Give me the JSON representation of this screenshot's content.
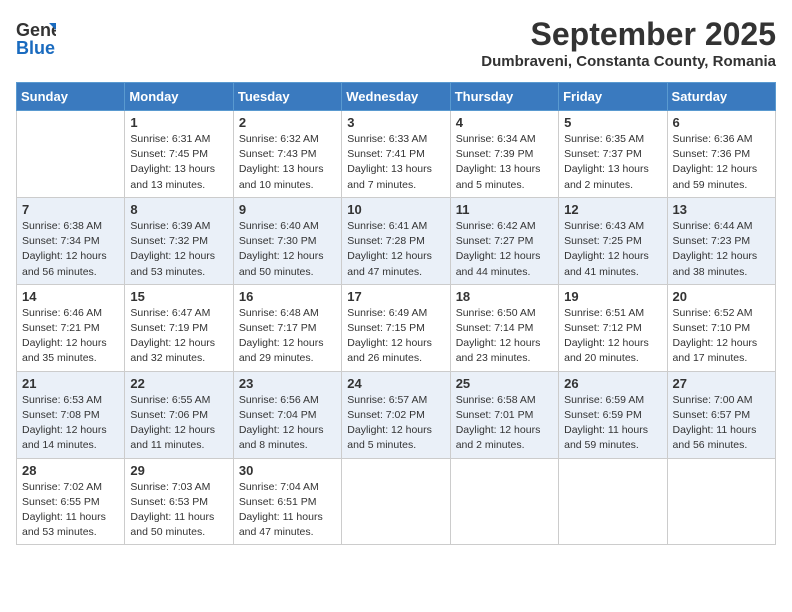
{
  "header": {
    "logo_general": "General",
    "logo_blue": "Blue",
    "month": "September 2025",
    "location": "Dumbraveni, Constanta County, Romania"
  },
  "weekdays": [
    "Sunday",
    "Monday",
    "Tuesday",
    "Wednesday",
    "Thursday",
    "Friday",
    "Saturday"
  ],
  "weeks": [
    [
      {
        "day": "",
        "sunrise": "",
        "sunset": "",
        "daylight": ""
      },
      {
        "day": "1",
        "sunrise": "Sunrise: 6:31 AM",
        "sunset": "Sunset: 7:45 PM",
        "daylight": "Daylight: 13 hours and 13 minutes."
      },
      {
        "day": "2",
        "sunrise": "Sunrise: 6:32 AM",
        "sunset": "Sunset: 7:43 PM",
        "daylight": "Daylight: 13 hours and 10 minutes."
      },
      {
        "day": "3",
        "sunrise": "Sunrise: 6:33 AM",
        "sunset": "Sunset: 7:41 PM",
        "daylight": "Daylight: 13 hours and 7 minutes."
      },
      {
        "day": "4",
        "sunrise": "Sunrise: 6:34 AM",
        "sunset": "Sunset: 7:39 PM",
        "daylight": "Daylight: 13 hours and 5 minutes."
      },
      {
        "day": "5",
        "sunrise": "Sunrise: 6:35 AM",
        "sunset": "Sunset: 7:37 PM",
        "daylight": "Daylight: 13 hours and 2 minutes."
      },
      {
        "day": "6",
        "sunrise": "Sunrise: 6:36 AM",
        "sunset": "Sunset: 7:36 PM",
        "daylight": "Daylight: 12 hours and 59 minutes."
      }
    ],
    [
      {
        "day": "7",
        "sunrise": "Sunrise: 6:38 AM",
        "sunset": "Sunset: 7:34 PM",
        "daylight": "Daylight: 12 hours and 56 minutes."
      },
      {
        "day": "8",
        "sunrise": "Sunrise: 6:39 AM",
        "sunset": "Sunset: 7:32 PM",
        "daylight": "Daylight: 12 hours and 53 minutes."
      },
      {
        "day": "9",
        "sunrise": "Sunrise: 6:40 AM",
        "sunset": "Sunset: 7:30 PM",
        "daylight": "Daylight: 12 hours and 50 minutes."
      },
      {
        "day": "10",
        "sunrise": "Sunrise: 6:41 AM",
        "sunset": "Sunset: 7:28 PM",
        "daylight": "Daylight: 12 hours and 47 minutes."
      },
      {
        "day": "11",
        "sunrise": "Sunrise: 6:42 AM",
        "sunset": "Sunset: 7:27 PM",
        "daylight": "Daylight: 12 hours and 44 minutes."
      },
      {
        "day": "12",
        "sunrise": "Sunrise: 6:43 AM",
        "sunset": "Sunset: 7:25 PM",
        "daylight": "Daylight: 12 hours and 41 minutes."
      },
      {
        "day": "13",
        "sunrise": "Sunrise: 6:44 AM",
        "sunset": "Sunset: 7:23 PM",
        "daylight": "Daylight: 12 hours and 38 minutes."
      }
    ],
    [
      {
        "day": "14",
        "sunrise": "Sunrise: 6:46 AM",
        "sunset": "Sunset: 7:21 PM",
        "daylight": "Daylight: 12 hours and 35 minutes."
      },
      {
        "day": "15",
        "sunrise": "Sunrise: 6:47 AM",
        "sunset": "Sunset: 7:19 PM",
        "daylight": "Daylight: 12 hours and 32 minutes."
      },
      {
        "day": "16",
        "sunrise": "Sunrise: 6:48 AM",
        "sunset": "Sunset: 7:17 PM",
        "daylight": "Daylight: 12 hours and 29 minutes."
      },
      {
        "day": "17",
        "sunrise": "Sunrise: 6:49 AM",
        "sunset": "Sunset: 7:15 PM",
        "daylight": "Daylight: 12 hours and 26 minutes."
      },
      {
        "day": "18",
        "sunrise": "Sunrise: 6:50 AM",
        "sunset": "Sunset: 7:14 PM",
        "daylight": "Daylight: 12 hours and 23 minutes."
      },
      {
        "day": "19",
        "sunrise": "Sunrise: 6:51 AM",
        "sunset": "Sunset: 7:12 PM",
        "daylight": "Daylight: 12 hours and 20 minutes."
      },
      {
        "day": "20",
        "sunrise": "Sunrise: 6:52 AM",
        "sunset": "Sunset: 7:10 PM",
        "daylight": "Daylight: 12 hours and 17 minutes."
      }
    ],
    [
      {
        "day": "21",
        "sunrise": "Sunrise: 6:53 AM",
        "sunset": "Sunset: 7:08 PM",
        "daylight": "Daylight: 12 hours and 14 minutes."
      },
      {
        "day": "22",
        "sunrise": "Sunrise: 6:55 AM",
        "sunset": "Sunset: 7:06 PM",
        "daylight": "Daylight: 12 hours and 11 minutes."
      },
      {
        "day": "23",
        "sunrise": "Sunrise: 6:56 AM",
        "sunset": "Sunset: 7:04 PM",
        "daylight": "Daylight: 12 hours and 8 minutes."
      },
      {
        "day": "24",
        "sunrise": "Sunrise: 6:57 AM",
        "sunset": "Sunset: 7:02 PM",
        "daylight": "Daylight: 12 hours and 5 minutes."
      },
      {
        "day": "25",
        "sunrise": "Sunrise: 6:58 AM",
        "sunset": "Sunset: 7:01 PM",
        "daylight": "Daylight: 12 hours and 2 minutes."
      },
      {
        "day": "26",
        "sunrise": "Sunrise: 6:59 AM",
        "sunset": "Sunset: 6:59 PM",
        "daylight": "Daylight: 11 hours and 59 minutes."
      },
      {
        "day": "27",
        "sunrise": "Sunrise: 7:00 AM",
        "sunset": "Sunset: 6:57 PM",
        "daylight": "Daylight: 11 hours and 56 minutes."
      }
    ],
    [
      {
        "day": "28",
        "sunrise": "Sunrise: 7:02 AM",
        "sunset": "Sunset: 6:55 PM",
        "daylight": "Daylight: 11 hours and 53 minutes."
      },
      {
        "day": "29",
        "sunrise": "Sunrise: 7:03 AM",
        "sunset": "Sunset: 6:53 PM",
        "daylight": "Daylight: 11 hours and 50 minutes."
      },
      {
        "day": "30",
        "sunrise": "Sunrise: 7:04 AM",
        "sunset": "Sunset: 6:51 PM",
        "daylight": "Daylight: 11 hours and 47 minutes."
      },
      {
        "day": "",
        "sunrise": "",
        "sunset": "",
        "daylight": ""
      },
      {
        "day": "",
        "sunrise": "",
        "sunset": "",
        "daylight": ""
      },
      {
        "day": "",
        "sunrise": "",
        "sunset": "",
        "daylight": ""
      },
      {
        "day": "",
        "sunrise": "",
        "sunset": "",
        "daylight": ""
      }
    ]
  ]
}
